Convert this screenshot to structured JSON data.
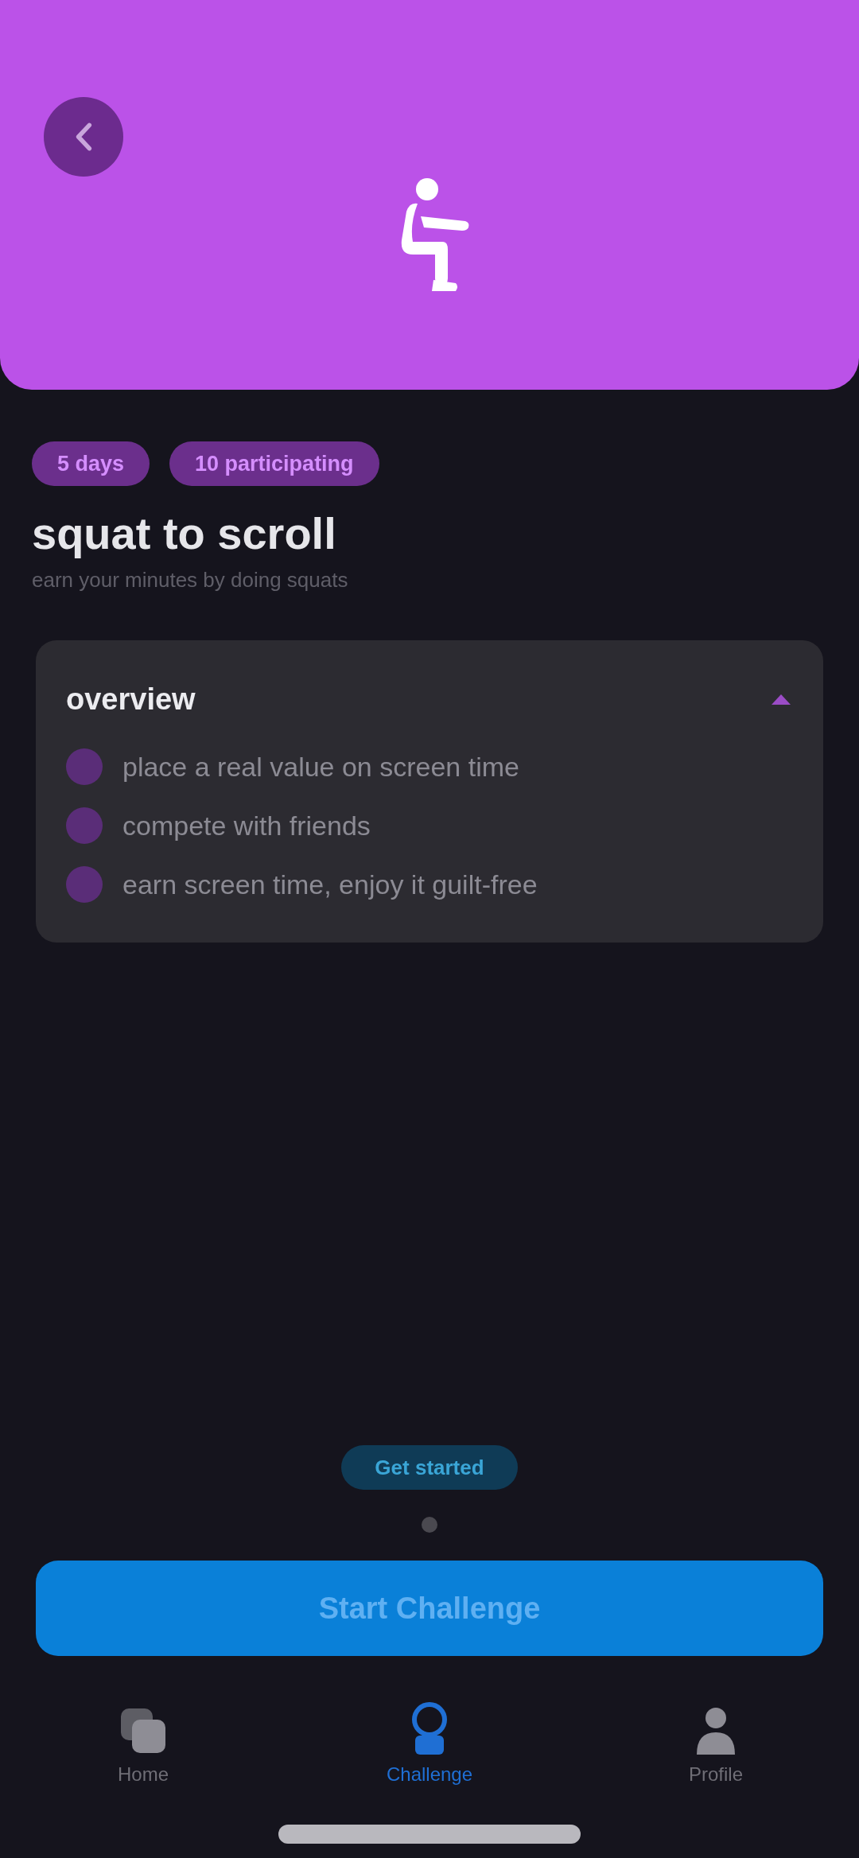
{
  "tags": [
    {
      "label": "5 days"
    },
    {
      "label": "10 participating"
    }
  ],
  "title": "squat to scroll",
  "subtitle": "earn your minutes by doing squats",
  "overview": {
    "title": "overview",
    "expanded": true,
    "items": [
      "place a real value on screen time",
      "compete with friends",
      "earn screen time, enjoy it guilt-free"
    ]
  },
  "hint": "Get started",
  "start_button": {
    "label": "Start Challenge"
  },
  "tab_bar": [
    {
      "kind": "home",
      "label": "Home",
      "selected": false
    },
    {
      "kind": "challenge",
      "label": "Challenge",
      "selected": true
    },
    {
      "kind": "profile",
      "label": "Profile",
      "selected": false
    }
  ]
}
